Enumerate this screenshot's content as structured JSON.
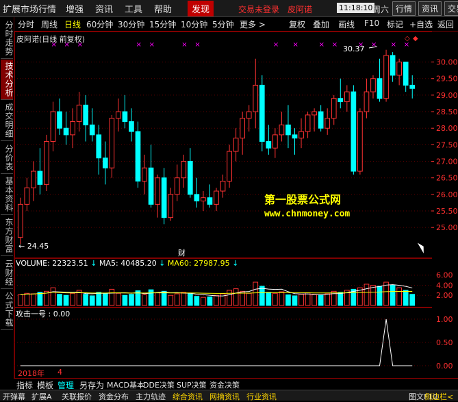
{
  "menu": {
    "items": [
      "扩展市场行情",
      "增强",
      "资讯",
      "工具",
      "帮助"
    ],
    "active": "发现",
    "notice": "交易未登录",
    "user": "皮阿诺",
    "time": "11:18:10",
    "weekday": "周六",
    "buttons": [
      "行情",
      "资讯",
      "交易"
    ]
  },
  "periods": {
    "items": [
      "分时",
      "周线",
      "日线",
      "60分钟",
      "30分钟",
      "15分钟",
      "10分钟",
      "5分钟",
      "更多 >"
    ],
    "selected": "日线",
    "tools": [
      "复权",
      "叠加",
      "画线",
      "F10",
      "标记",
      "+自选",
      "返回"
    ]
  },
  "left_tabs": [
    "分时走势",
    "技术分析",
    "成交明细",
    "分价表",
    "基本资料",
    "东方财富",
    "云财经",
    "公式下载"
  ],
  "left_tab_selected": "技术分析",
  "main": {
    "title": "皮阿诺(日线 前复权)",
    "high_label": "30.37",
    "low_label": "24.45",
    "cai_label": "财",
    "watermark_title": "第一股票公式网",
    "watermark_url": "www.chnmoney.com"
  },
  "volume": {
    "label": "VOLUME: 22323.51",
    "ma5": "MA5: 40485.20",
    "ma60": "MA60: 27987.95"
  },
  "indicator": {
    "label": "攻击一号 : 0.00",
    "year": "2018年",
    "month": "4"
  },
  "bottom_tabs": [
    "指标",
    "模板",
    "管理",
    "另存为",
    "MACD基本",
    "DDE决策",
    "SUP决策",
    "资金决策"
  ],
  "bottom_tab_selected": "管理",
  "status": [
    "开弹幕",
    "扩展A",
    "关联报价",
    "资金分布",
    "主力轨迹",
    "综合资讯",
    "网摘资讯",
    "行业资讯"
  ],
  "status_right": [
    "图文F10",
    "侧边栏<"
  ],
  "colors": {
    "up": "#ff3232",
    "down": "#00ffff",
    "bg": "#000000",
    "border": "#800000"
  },
  "chart_data": {
    "type": "candlestick",
    "y_ticks": [
      30.0,
      29.5,
      29.0,
      28.5,
      28.0,
      27.5,
      27.0,
      26.5,
      26.0,
      25.5,
      25.0
    ],
    "ylim": [
      24.3,
      30.55
    ],
    "vol_ticks": [
      6.0,
      4.0,
      2.0
    ],
    "ind_ticks": [
      1.0,
      0.5,
      0.0
    ],
    "candles": [
      {
        "o": 24.7,
        "h": 25.9,
        "l": 24.5,
        "c": 25.7
      },
      {
        "o": 25.7,
        "h": 26.5,
        "l": 25.5,
        "c": 26.2
      },
      {
        "o": 26.2,
        "h": 27.0,
        "l": 25.8,
        "c": 26.7
      },
      {
        "o": 26.7,
        "h": 27.4,
        "l": 26.0,
        "c": 26.3
      },
      {
        "o": 26.3,
        "h": 27.8,
        "l": 26.1,
        "c": 27.6
      },
      {
        "o": 27.6,
        "h": 28.8,
        "l": 27.3,
        "c": 28.5
      },
      {
        "o": 28.5,
        "h": 28.9,
        "l": 27.8,
        "c": 28.0
      },
      {
        "o": 28.0,
        "h": 28.5,
        "l": 27.5,
        "c": 27.8
      },
      {
        "o": 27.8,
        "h": 28.6,
        "l": 27.4,
        "c": 28.2
      },
      {
        "o": 28.2,
        "h": 29.1,
        "l": 27.9,
        "c": 28.7
      },
      {
        "o": 28.7,
        "h": 29.0,
        "l": 27.6,
        "c": 28.1
      },
      {
        "o": 28.1,
        "h": 28.6,
        "l": 27.6,
        "c": 27.8
      },
      {
        "o": 27.8,
        "h": 28.1,
        "l": 26.6,
        "c": 27.1
      },
      {
        "o": 27.1,
        "h": 27.6,
        "l": 26.3,
        "c": 26.8
      },
      {
        "o": 26.8,
        "h": 28.4,
        "l": 26.5,
        "c": 28.3
      },
      {
        "o": 28.3,
        "h": 28.9,
        "l": 27.9,
        "c": 28.5
      },
      {
        "o": 28.5,
        "h": 29.0,
        "l": 28.0,
        "c": 28.2
      },
      {
        "o": 28.2,
        "h": 28.6,
        "l": 27.6,
        "c": 27.9
      },
      {
        "o": 27.9,
        "h": 28.2,
        "l": 26.2,
        "c": 26.4
      },
      {
        "o": 26.4,
        "h": 27.2,
        "l": 26.0,
        "c": 26.8
      },
      {
        "o": 26.8,
        "h": 27.5,
        "l": 25.6,
        "c": 25.7
      },
      {
        "o": 25.7,
        "h": 26.6,
        "l": 25.3,
        "c": 26.5
      },
      {
        "o": 26.5,
        "h": 26.8,
        "l": 25.1,
        "c": 25.3
      },
      {
        "o": 25.3,
        "h": 26.2,
        "l": 25.2,
        "c": 26.0
      },
      {
        "o": 26.0,
        "h": 26.9,
        "l": 25.8,
        "c": 26.5
      },
      {
        "o": 26.5,
        "h": 27.2,
        "l": 26.2,
        "c": 27.0
      },
      {
        "o": 27.0,
        "h": 27.4,
        "l": 25.9,
        "c": 26.0
      },
      {
        "o": 26.0,
        "h": 26.5,
        "l": 25.6,
        "c": 25.8
      },
      {
        "o": 25.8,
        "h": 26.1,
        "l": 25.5,
        "c": 25.9
      },
      {
        "o": 25.9,
        "h": 26.3,
        "l": 25.6,
        "c": 25.7
      },
      {
        "o": 25.7,
        "h": 26.2,
        "l": 25.5,
        "c": 26.1
      },
      {
        "o": 26.1,
        "h": 26.6,
        "l": 25.9,
        "c": 26.4
      },
      {
        "o": 26.4,
        "h": 27.5,
        "l": 26.2,
        "c": 27.3
      },
      {
        "o": 27.3,
        "h": 28.0,
        "l": 27.0,
        "c": 27.7
      },
      {
        "o": 27.7,
        "h": 28.5,
        "l": 27.2,
        "c": 28.3
      },
      {
        "o": 28.3,
        "h": 28.7,
        "l": 27.9,
        "c": 28.5
      },
      {
        "o": 28.5,
        "h": 30.1,
        "l": 28.0,
        "c": 29.3
      },
      {
        "o": 29.3,
        "h": 29.6,
        "l": 27.3,
        "c": 27.6
      },
      {
        "o": 27.6,
        "h": 28.1,
        "l": 27.2,
        "c": 27.4
      },
      {
        "o": 27.4,
        "h": 28.0,
        "l": 27.1,
        "c": 27.8
      },
      {
        "o": 27.8,
        "h": 28.5,
        "l": 27.6,
        "c": 28.1
      },
      {
        "o": 28.1,
        "h": 28.7,
        "l": 27.4,
        "c": 27.8
      },
      {
        "o": 27.8,
        "h": 28.0,
        "l": 27.2,
        "c": 27.7
      },
      {
        "o": 27.7,
        "h": 28.3,
        "l": 27.4,
        "c": 27.9
      },
      {
        "o": 27.9,
        "h": 28.5,
        "l": 27.7,
        "c": 28.4
      },
      {
        "o": 28.4,
        "h": 28.6,
        "l": 27.9,
        "c": 28.5
      },
      {
        "o": 28.5,
        "h": 28.7,
        "l": 27.9,
        "c": 28.0
      },
      {
        "o": 28.0,
        "h": 28.6,
        "l": 27.8,
        "c": 28.3
      },
      {
        "o": 28.3,
        "h": 29.0,
        "l": 28.1,
        "c": 28.9
      },
      {
        "o": 28.9,
        "h": 29.5,
        "l": 28.6,
        "c": 28.8
      },
      {
        "o": 28.8,
        "h": 29.3,
        "l": 28.5,
        "c": 29.1
      },
      {
        "o": 29.1,
        "h": 29.3,
        "l": 26.6,
        "c": 26.7
      },
      {
        "o": 26.7,
        "h": 28.6,
        "l": 26.6,
        "c": 28.5
      },
      {
        "o": 28.5,
        "h": 29.5,
        "l": 28.3,
        "c": 29.1
      },
      {
        "o": 29.1,
        "h": 29.6,
        "l": 28.9,
        "c": 29.5
      },
      {
        "o": 29.5,
        "h": 30.1,
        "l": 28.8,
        "c": 28.9
      },
      {
        "o": 28.9,
        "h": 30.37,
        "l": 28.8,
        "c": 30.2
      },
      {
        "o": 30.2,
        "h": 30.3,
        "l": 29.4,
        "c": 29.6
      },
      {
        "o": 29.6,
        "h": 30.1,
        "l": 29.3,
        "c": 30.0
      },
      {
        "o": 30.0,
        "h": 30.0,
        "l": 29.1,
        "c": 29.3
      },
      {
        "o": 29.3,
        "h": 29.6,
        "l": 28.9,
        "c": 29.2
      }
    ],
    "volumes": [
      2.1,
      2.4,
      2.3,
      2.6,
      2.8,
      3.5,
      2.2,
      2.0,
      2.4,
      3.0,
      2.2,
      1.9,
      2.6,
      2.3,
      3.2,
      2.4,
      2.0,
      2.2,
      2.9,
      2.1,
      3.1,
      2.5,
      2.8,
      2.0,
      2.3,
      2.6,
      2.4,
      1.8,
      1.6,
      1.7,
      2.0,
      2.3,
      3.0,
      3.3,
      2.8,
      2.4,
      4.6,
      3.8,
      2.6,
      2.4,
      2.7,
      2.1,
      1.9,
      2.2,
      2.5,
      2.1,
      2.0,
      2.3,
      2.8,
      2.6,
      3.0,
      3.2,
      3.5,
      4.2,
      4.0,
      3.8,
      4.6,
      4.0,
      3.5,
      3.0,
      2.2
    ],
    "signal_index": 56
  }
}
